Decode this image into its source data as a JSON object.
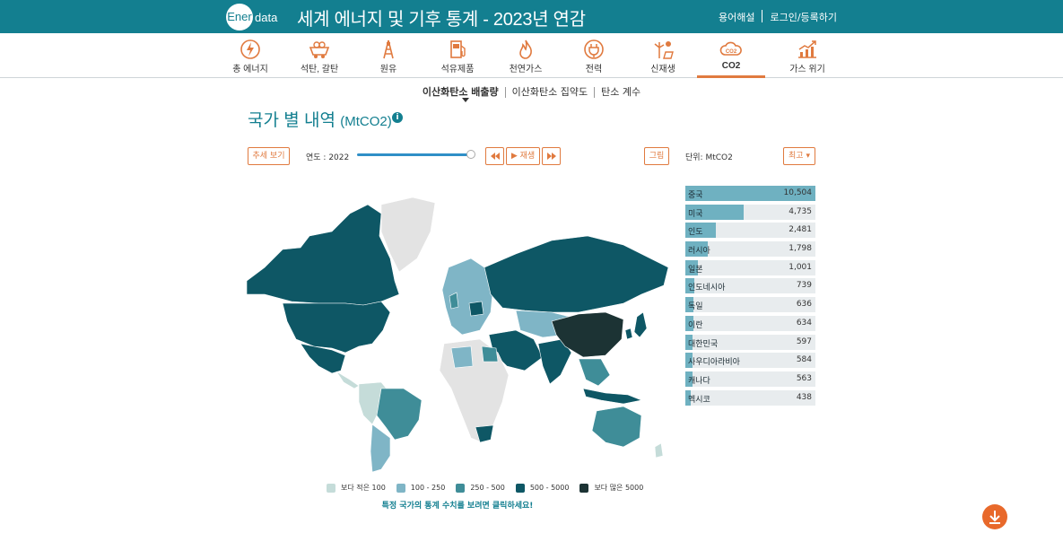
{
  "header": {
    "logo_mark": "Ener",
    "logo_rest": "data",
    "title": "세계 에너지 및 기후 통계 - 2023년 연감",
    "links": [
      "용어해설",
      "로그인/등록하기"
    ]
  },
  "nav": {
    "items": [
      {
        "label": "총 에너지",
        "icon": "lightning-icon",
        "active": false
      },
      {
        "label": "석탄, 갈탄",
        "icon": "coal-cart-icon",
        "active": false
      },
      {
        "label": "원유",
        "icon": "oil-rig-icon",
        "active": false
      },
      {
        "label": "석유제품",
        "icon": "fuel-pump-icon",
        "active": false
      },
      {
        "label": "천연가스",
        "icon": "flame-icon",
        "active": false
      },
      {
        "label": "전력",
        "icon": "plug-icon",
        "active": false
      },
      {
        "label": "신재생",
        "icon": "wind-solar-icon",
        "active": false
      },
      {
        "label": "CO2",
        "icon": "co2-cloud-icon",
        "active": true
      },
      {
        "label": "가스 위기",
        "icon": "trend-chart-icon",
        "active": false
      }
    ]
  },
  "subtabs": {
    "items": [
      "이산화탄소 배출량",
      "이산화탄소 집약도",
      "탄소 계수"
    ],
    "active": 0
  },
  "page": {
    "title": "국가 별 내역",
    "title_unit": "(MtCO2)"
  },
  "controls": {
    "trend_button": "추세 보기",
    "year_label": "연도 : 2022",
    "slider_fraction": 1.0,
    "rewind_icon": "rewind-icon",
    "play_label": "▶ 재생",
    "forward_icon": "fast-forward-icon",
    "chart_button": "그림",
    "unit_label": "단위: MtCO2",
    "sort_button": "최고"
  },
  "ranking": {
    "max": 10504,
    "rows": [
      {
        "name": "중국",
        "value": 10504,
        "display": "10,504"
      },
      {
        "name": "미국",
        "value": 4735,
        "display": "4,735"
      },
      {
        "name": "인도",
        "value": 2481,
        "display": "2,481"
      },
      {
        "name": "러시아",
        "value": 1798,
        "display": "1,798"
      },
      {
        "name": "일본",
        "value": 1001,
        "display": "1,001"
      },
      {
        "name": "인도네시아",
        "value": 739,
        "display": "739"
      },
      {
        "name": "독일",
        "value": 636,
        "display": "636"
      },
      {
        "name": "이란",
        "value": 634,
        "display": "634"
      },
      {
        "name": "대한민국",
        "value": 597,
        "display": "597"
      },
      {
        "name": "사우디아라비아",
        "value": 584,
        "display": "584"
      },
      {
        "name": "캐나다",
        "value": 563,
        "display": "563"
      },
      {
        "name": "멕시코",
        "value": 438,
        "display": "438"
      }
    ]
  },
  "legend": [
    {
      "label": "보다 적은 100",
      "color": "#c5dcd9"
    },
    {
      "label": "100 - 250",
      "color": "#7fb5c6"
    },
    {
      "label": "250 - 500",
      "color": "#3f8d98"
    },
    {
      "label": "500 - 5000",
      "color": "#0e5765"
    },
    {
      "label": "보다 많은 5000",
      "color": "#1c3334"
    }
  ],
  "hint": "특정 국가의 통계 수치를 보려면 클릭하세요!",
  "colors": {
    "brand": "#137f90",
    "accent": "#e07a3f",
    "no_data": "#e3e3e3"
  }
}
